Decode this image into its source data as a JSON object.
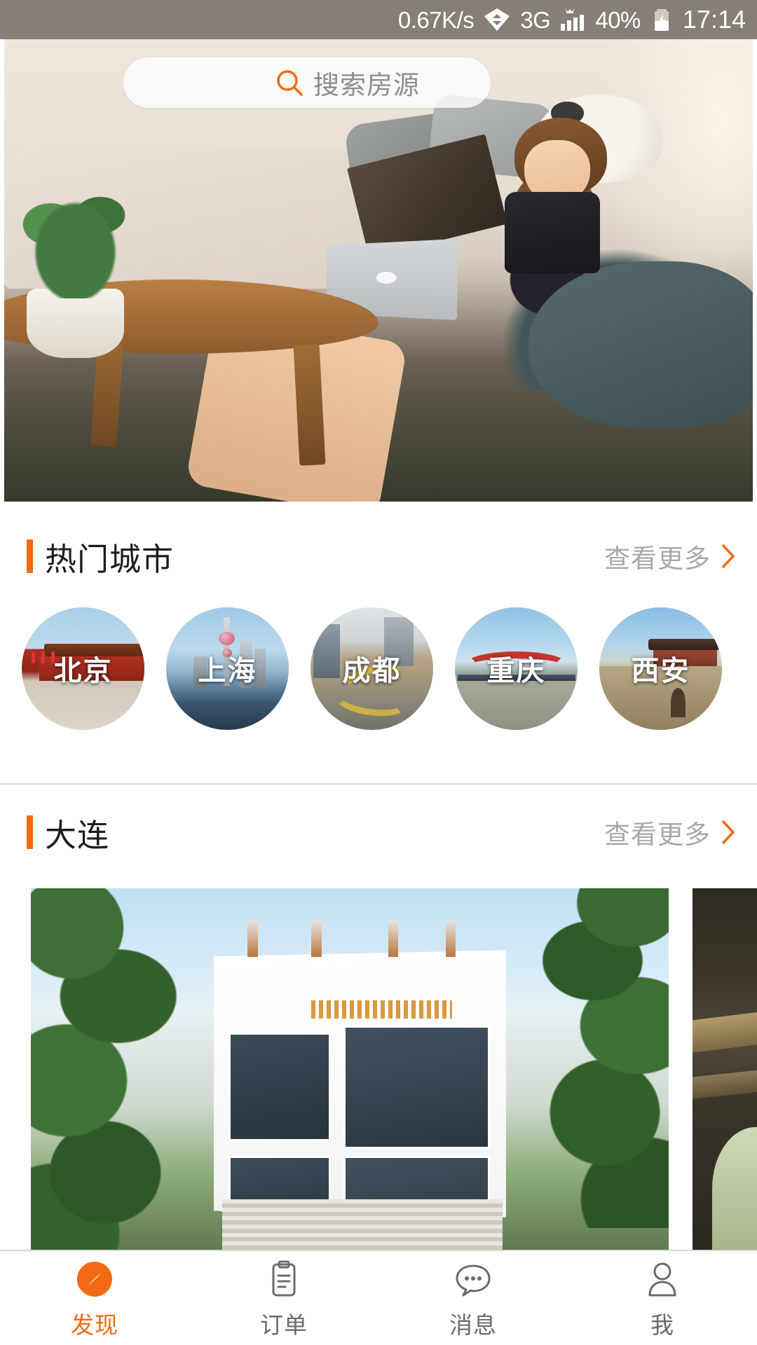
{
  "status_bar": {
    "network_speed": "0.67K/s",
    "network_type": "3G",
    "battery_percent": "40%",
    "time": "17:14",
    "icons": [
      "data-transfer-icon",
      "signal-bars-icon",
      "battery-charging-icon"
    ],
    "background_color": "#857f78"
  },
  "search": {
    "placeholder": "搜索房源",
    "icon": "search-icon",
    "icon_color": "#f26a14"
  },
  "theme": {
    "accent": "#f26a14",
    "muted_text": "#a8a8a8",
    "title_text": "#1d1d1d",
    "divider": "#dcdcdc"
  },
  "sections": [
    {
      "title": "热门城市",
      "more_label": "查看更多",
      "more_icon": "chevron-right-icon"
    },
    {
      "title": "大连",
      "more_label": "查看更多",
      "more_icon": "chevron-right-icon"
    }
  ],
  "cities": [
    {
      "name": "北京",
      "thumb": "beijing-tiananmen-thumb"
    },
    {
      "name": "上海",
      "thumb": "shanghai-skyline-thumb"
    },
    {
      "name": "成都",
      "thumb": "chengdu-cityscape-thumb"
    },
    {
      "name": "重庆",
      "thumb": "chongqing-bridge-thumb"
    },
    {
      "name": "西安",
      "thumb": "xian-citywall-thumb"
    }
  ],
  "listings": [
    {
      "image": "white-modern-villa-photo"
    },
    {
      "image": "dark-wood-interior-photo"
    }
  ],
  "tabbar": {
    "items": [
      {
        "label": "发现",
        "icon": "compass-icon",
        "active": true
      },
      {
        "label": "订单",
        "icon": "clipboard-icon",
        "active": false
      },
      {
        "label": "消息",
        "icon": "chat-bubble-icon",
        "active": false
      },
      {
        "label": "我",
        "icon": "person-icon",
        "active": false
      }
    ]
  }
}
